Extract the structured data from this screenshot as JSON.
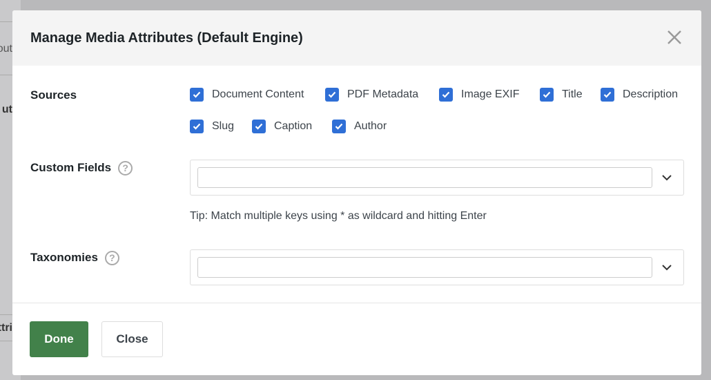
{
  "background": {
    "fragments": [
      "out",
      "ut",
      "ttri"
    ]
  },
  "modal": {
    "title": "Manage Media Attributes (Default Engine)",
    "sources": {
      "label": "Sources",
      "options": [
        {
          "label": "Document Content",
          "checked": true
        },
        {
          "label": "PDF Metadata",
          "checked": true
        },
        {
          "label": "Image EXIF",
          "checked": true
        },
        {
          "label": "Title",
          "checked": true
        },
        {
          "label": "Description",
          "checked": true
        },
        {
          "label": "Slug",
          "checked": true
        },
        {
          "label": "Caption",
          "checked": true
        },
        {
          "label": "Author",
          "checked": true
        }
      ]
    },
    "custom_fields": {
      "label": "Custom Fields",
      "help": "?",
      "value": "",
      "tip": "Tip: Match multiple keys using * as wildcard and hitting Enter"
    },
    "taxonomies": {
      "label": "Taxonomies",
      "help": "?",
      "value": ""
    },
    "done_label": "Done",
    "close_label": "Close"
  },
  "colors": {
    "accent": "#2f6fd6",
    "done": "#42814a"
  }
}
